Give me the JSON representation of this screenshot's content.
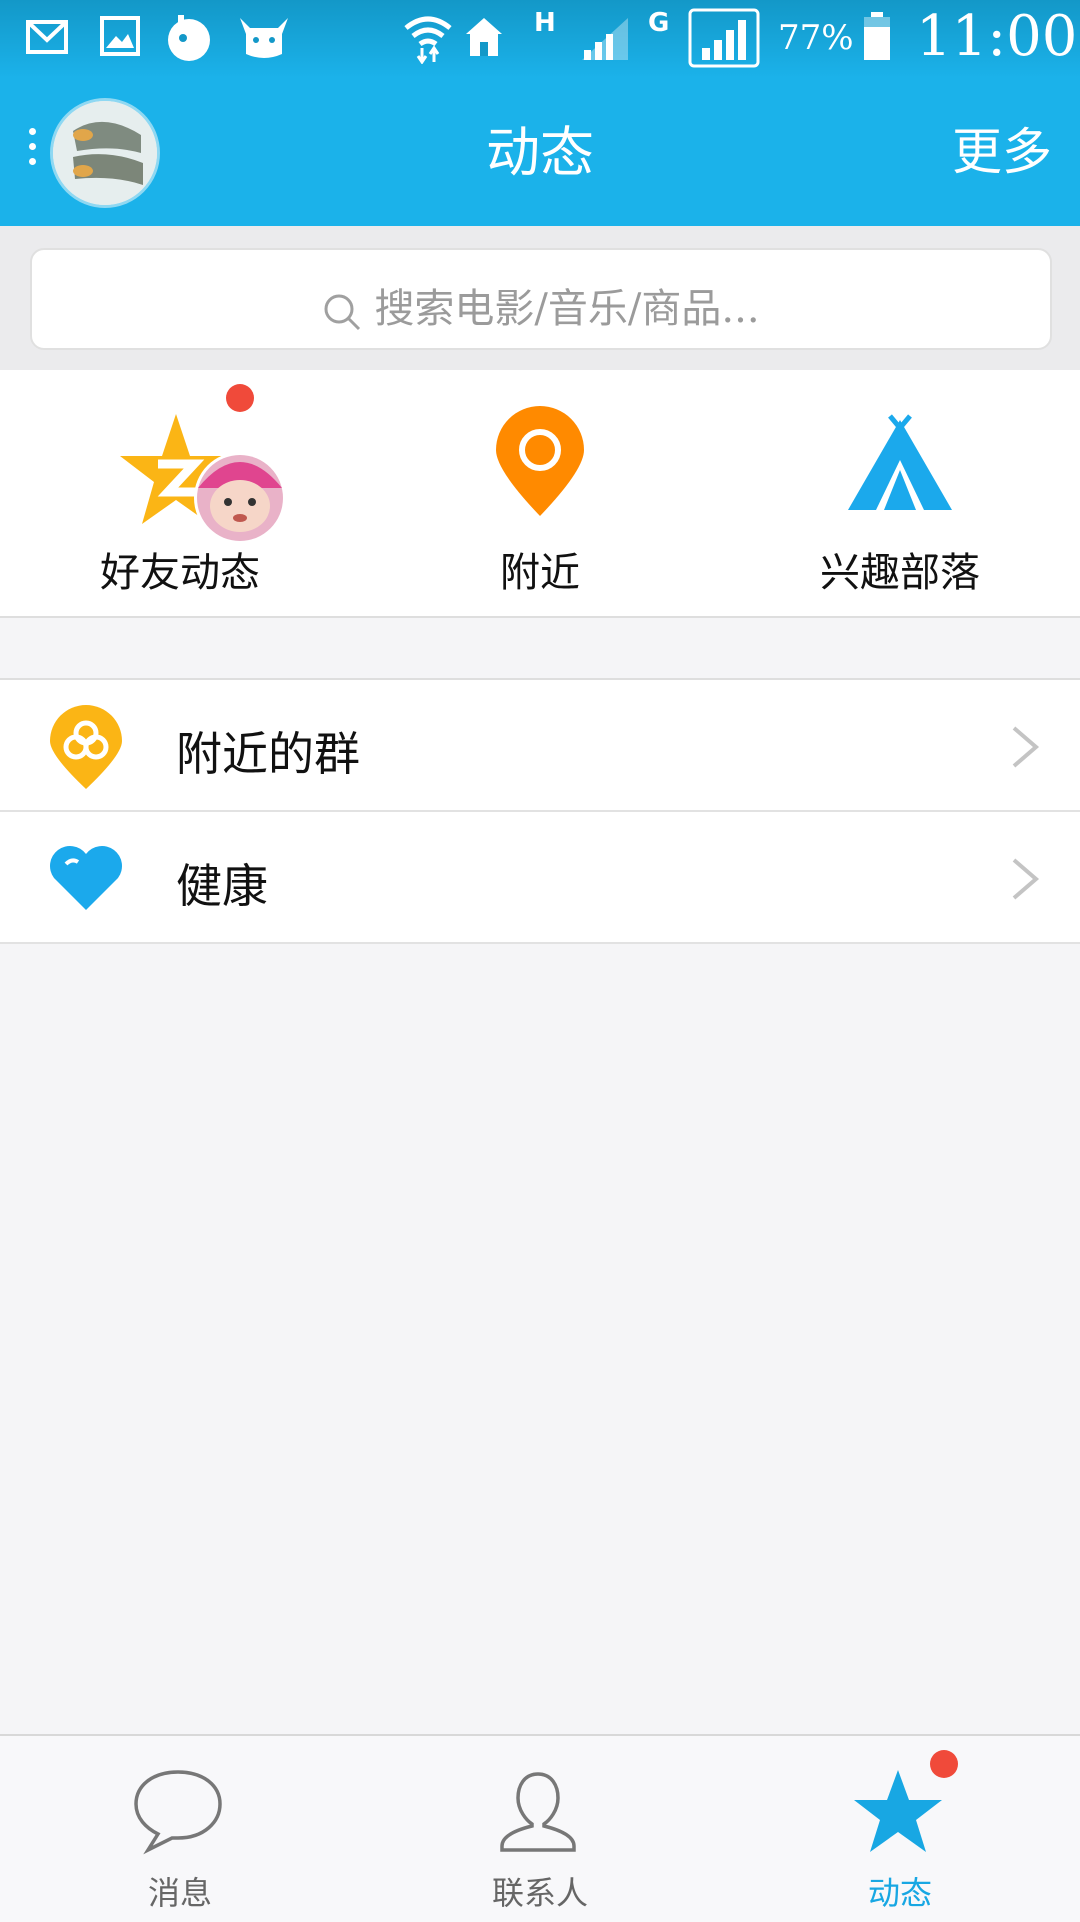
{
  "status_bar": {
    "battery_percent": "77%",
    "time": "11:00",
    "network_h": "H",
    "network_g": "G",
    "icons": [
      "mail-icon",
      "image-icon",
      "app-icon",
      "cow-icon",
      "wifi-icon",
      "home-icon",
      "signal-icon",
      "signal-icon",
      "battery-icon"
    ]
  },
  "header": {
    "title": "动态",
    "more": "更多"
  },
  "search": {
    "placeholder": "搜索电影/音乐/商品..."
  },
  "quick_entries": [
    {
      "label": "好友动态",
      "icon": "qzone-star-icon",
      "has_badge": true
    },
    {
      "label": "附近",
      "icon": "location-pin-icon"
    },
    {
      "label": "兴趣部落",
      "icon": "tent-icon"
    }
  ],
  "list_items": [
    {
      "label": "附近的群",
      "icon": "group-pin-icon"
    },
    {
      "label": "健康",
      "icon": "heart-icon"
    }
  ],
  "tabs": [
    {
      "label": "消息",
      "icon": "chat-bubble-icon"
    },
    {
      "label": "联系人",
      "icon": "contact-icon"
    },
    {
      "label": "动态",
      "icon": "star-icon",
      "active": true,
      "has_badge": true
    }
  ],
  "colors": {
    "brand": "#1bb2ea",
    "tab_active": "#18a7e3",
    "badge": "#f04a3a",
    "pin_orange": "#ff8a00",
    "star_yellow": "#fbb515"
  }
}
